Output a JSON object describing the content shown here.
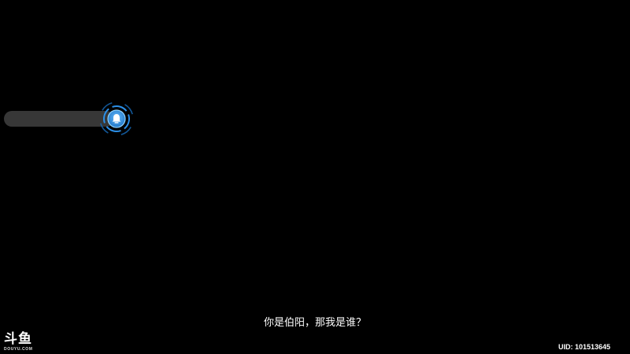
{
  "hud": {
    "indicator_icon": "bell-icon"
  },
  "subtitle": {
    "text": "你是伯阳，那我是谁？"
  },
  "watermark": {
    "logo_text": "斗鱼",
    "logo_subtext": "DOUYU.COM"
  },
  "footer": {
    "uid": "UID: 101513645"
  },
  "colors": {
    "background": "#000000",
    "bar": "#3a3a3a",
    "accent": "#2b8fe8",
    "text": "#ffffff"
  }
}
